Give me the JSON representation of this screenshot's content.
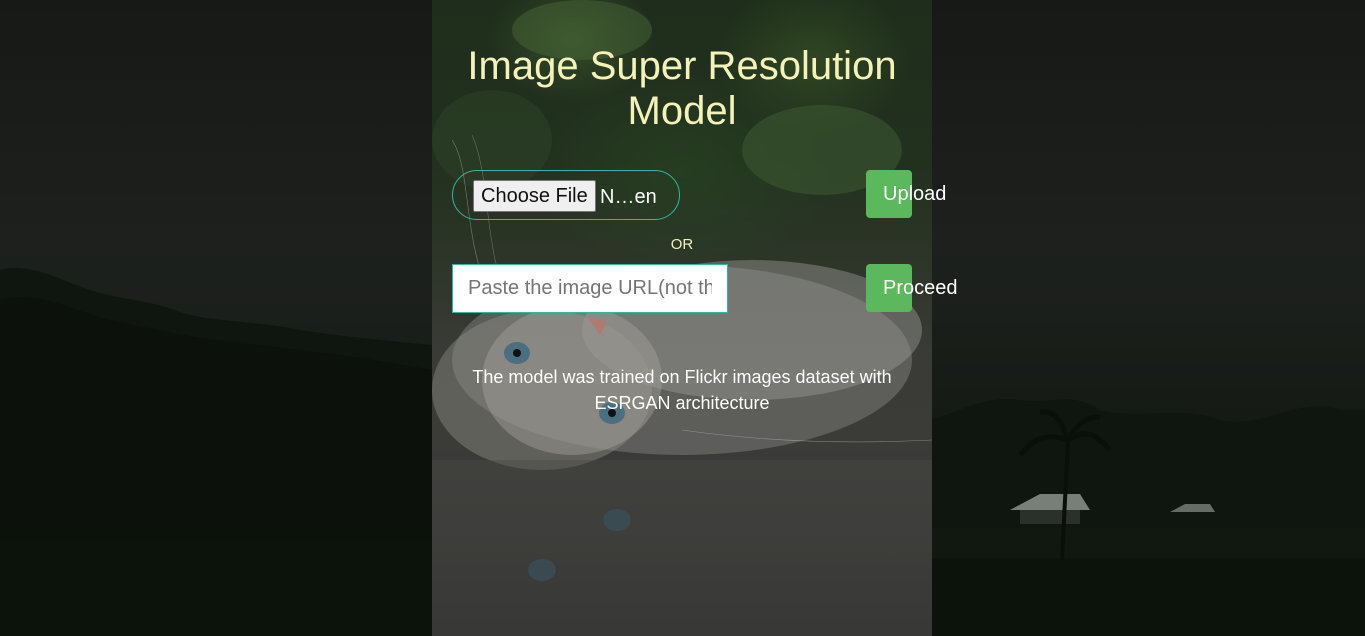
{
  "page": {
    "title": "Image Super Resolution Model"
  },
  "upload_form": {
    "choose_file_label": "Choose File",
    "file_name": "N…en",
    "upload_label": "Upload"
  },
  "separator": {
    "or_text": "OR"
  },
  "url_form": {
    "url_placeholder": "Paste the image URL(not the image)",
    "url_value": "",
    "proceed_label": "Proceed"
  },
  "description": {
    "text": "The model was trained on Flickr images dataset with ESRGAN architecture"
  },
  "colors": {
    "title": "#f3f2b8",
    "button_green": "#5cb85c",
    "input_border": "#2fb89d"
  }
}
